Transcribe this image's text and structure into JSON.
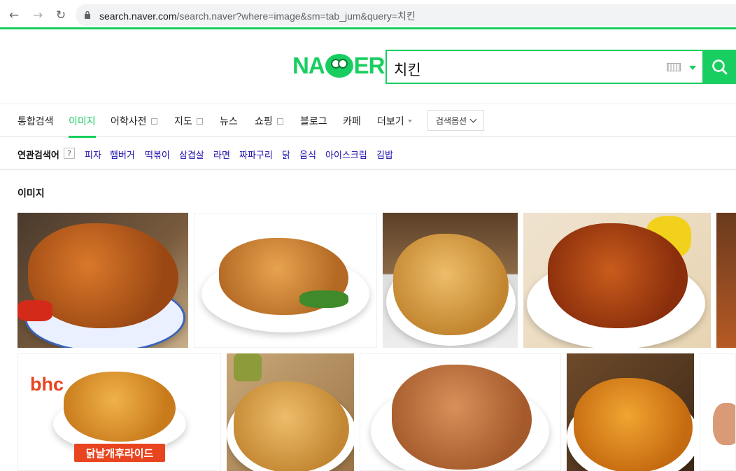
{
  "browser": {
    "url_host": "search.naver.com",
    "url_path": "/search.naver?where=image&sm=tab_jum&query=치킨"
  },
  "header": {
    "logo_text": "NAVER",
    "query": "치킨"
  },
  "tabs": [
    "통합검색",
    "이미지",
    "어학사전",
    "지도",
    "뉴스",
    "쇼핑",
    "블로그",
    "카페",
    "더보기"
  ],
  "active_tab": "이미지",
  "search_options_label": "검색옵션",
  "related": {
    "title": "연관검색어",
    "help": "?",
    "items": [
      "피자",
      "햄버거",
      "떡볶이",
      "삼겹살",
      "라면",
      "짜파구리",
      "닭",
      "음식",
      "아이스크림",
      "김밥"
    ]
  },
  "section_title": "이미지",
  "image_texts": {
    "brand": "bhc",
    "product": "닭날개후라이드"
  },
  "colors": {
    "accent": "#19ce60",
    "link": "#1a0dab"
  }
}
